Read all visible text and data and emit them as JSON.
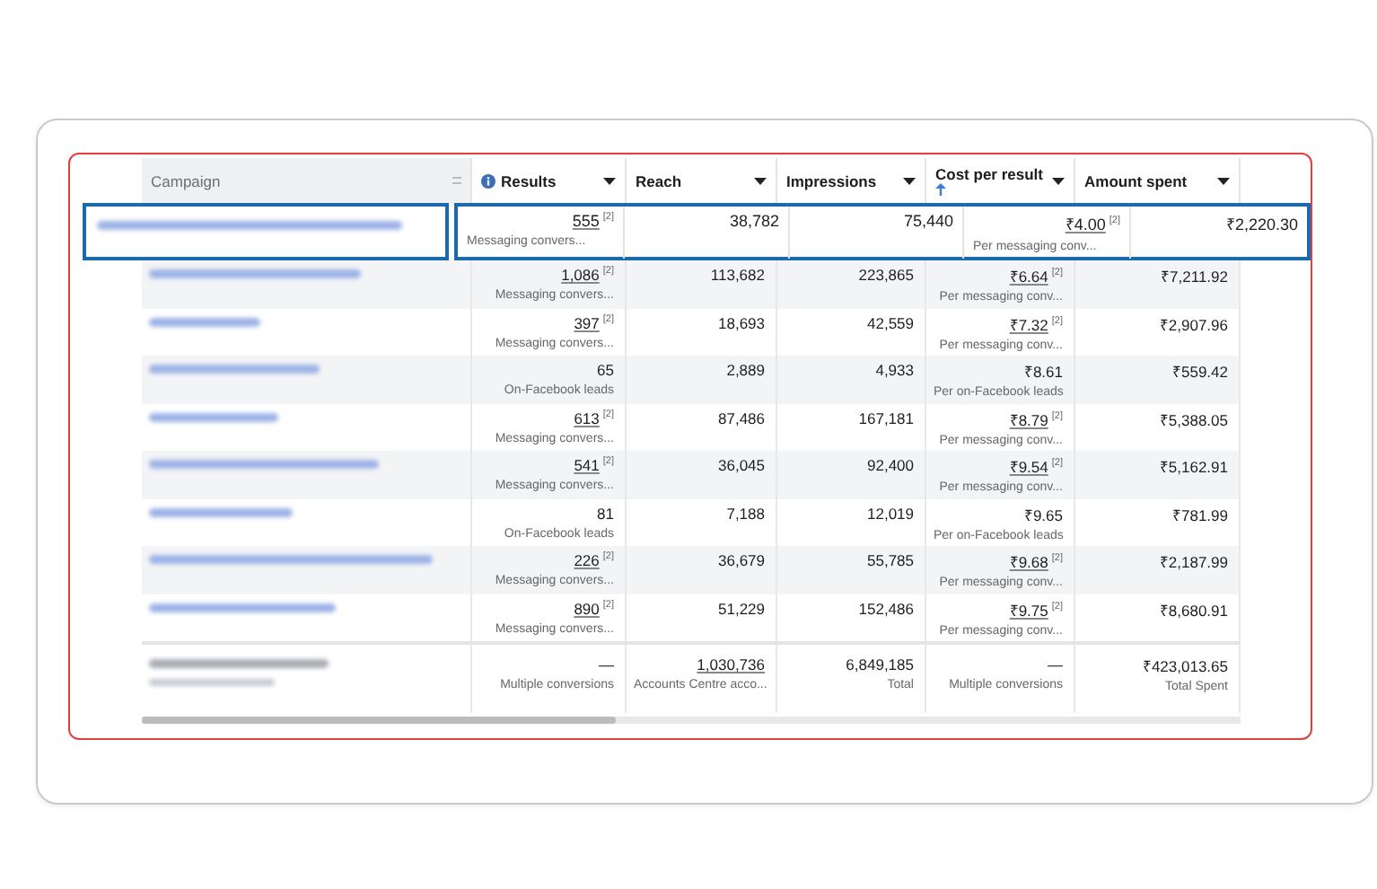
{
  "columns": [
    {
      "label": "Campaign",
      "info": false,
      "sorted": false,
      "dropdown": false
    },
    {
      "label": "Results",
      "info": true,
      "sorted": false,
      "dropdown": true
    },
    {
      "label": "Reach",
      "info": false,
      "sorted": false,
      "dropdown": true
    },
    {
      "label": "Impressions",
      "info": false,
      "sorted": false,
      "dropdown": true
    },
    {
      "label": "Cost per result",
      "info": false,
      "sorted": true,
      "dropdown": true
    },
    {
      "label": "Amount spent",
      "info": false,
      "sorted": false,
      "dropdown": true
    }
  ],
  "highlighted_row": {
    "results": {
      "value": "555",
      "linked": true,
      "note": "[2]",
      "sub": "Messaging convers..."
    },
    "reach": "38,782",
    "impressions": "75,440",
    "cost": {
      "value": "₹4.00",
      "linked": true,
      "note": "[2]",
      "sub": "Per messaging conv..."
    },
    "amount": "₹2,220.30"
  },
  "rows": [
    {
      "results": {
        "value": "1,086",
        "linked": true,
        "note": "[2]",
        "sub": "Messaging convers..."
      },
      "reach": "113,682",
      "impressions": "223,865",
      "cost": {
        "value": "₹6.64",
        "linked": true,
        "note": "[2]",
        "sub": "Per messaging conv..."
      },
      "amount": "₹7,211.92"
    },
    {
      "results": {
        "value": "397",
        "linked": true,
        "note": "[2]",
        "sub": "Messaging convers..."
      },
      "reach": "18,693",
      "impressions": "42,559",
      "cost": {
        "value": "₹7.32",
        "linked": true,
        "note": "[2]",
        "sub": "Per messaging conv..."
      },
      "amount": "₹2,907.96"
    },
    {
      "results": {
        "value": "65",
        "linked": false,
        "sub": "On-Facebook leads"
      },
      "reach": "2,889",
      "impressions": "4,933",
      "cost": {
        "value": "₹8.61",
        "linked": false,
        "sub": "Per on-Facebook leads"
      },
      "amount": "₹559.42"
    },
    {
      "results": {
        "value": "613",
        "linked": true,
        "note": "[2]",
        "sub": "Messaging convers..."
      },
      "reach": "87,486",
      "impressions": "167,181",
      "cost": {
        "value": "₹8.79",
        "linked": true,
        "note": "[2]",
        "sub": "Per messaging conv..."
      },
      "amount": "₹5,388.05"
    },
    {
      "results": {
        "value": "541",
        "linked": true,
        "note": "[2]",
        "sub": "Messaging convers..."
      },
      "reach": "36,045",
      "impressions": "92,400",
      "cost": {
        "value": "₹9.54",
        "linked": true,
        "note": "[2]",
        "sub": "Per messaging conv..."
      },
      "amount": "₹5,162.91"
    },
    {
      "results": {
        "value": "81",
        "linked": false,
        "sub": "On-Facebook leads"
      },
      "reach": "7,188",
      "impressions": "12,019",
      "cost": {
        "value": "₹9.65",
        "linked": false,
        "sub": "Per on-Facebook leads"
      },
      "amount": "₹781.99"
    },
    {
      "results": {
        "value": "226",
        "linked": true,
        "note": "[2]",
        "sub": "Messaging convers..."
      },
      "reach": "36,679",
      "impressions": "55,785",
      "cost": {
        "value": "₹9.68",
        "linked": true,
        "note": "[2]",
        "sub": "Per messaging conv..."
      },
      "amount": "₹2,187.99"
    },
    {
      "results": {
        "value": "890",
        "linked": true,
        "note": "[2]",
        "sub": "Messaging convers..."
      },
      "reach": "51,229",
      "impressions": "152,486",
      "cost": {
        "value": "₹9.75",
        "linked": true,
        "note": "[2]",
        "sub": "Per messaging conv..."
      },
      "amount": "₹8,680.91"
    }
  ],
  "summary": {
    "results": {
      "value": "—",
      "sub": "Multiple conversions"
    },
    "reach": {
      "value": "1,030,736",
      "linked": true,
      "sub": "Accounts Centre acco..."
    },
    "impressions": {
      "value": "6,849,185",
      "sub": "Total"
    },
    "cost": {
      "value": "—",
      "sub": "Multiple conversions"
    },
    "amount": {
      "value": "₹423,013.65",
      "sub": "Total Spent"
    }
  }
}
